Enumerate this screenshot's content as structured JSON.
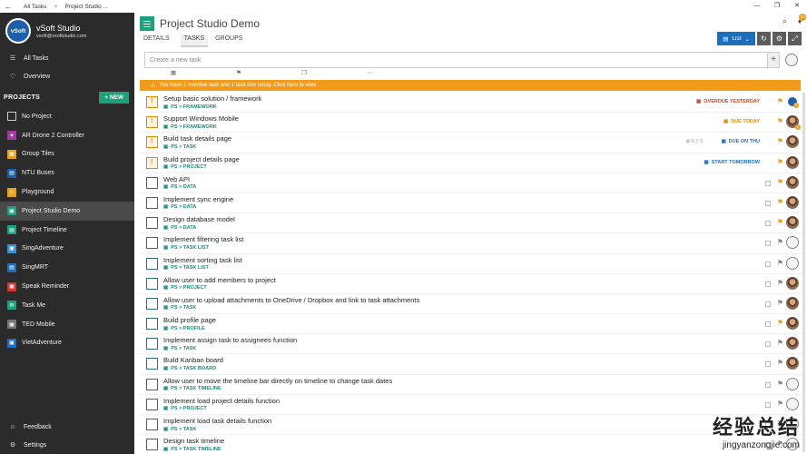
{
  "titlebar": {
    "back_icon": "back-arrow-icon",
    "crumb1": "All Tasks",
    "sep": ">",
    "crumb2": "Project Studio ...",
    "min": "—",
    "max": "❐",
    "close": "✕"
  },
  "account": {
    "logo_text": "vSoft",
    "name": "vSoft Studio",
    "email": "vsoft@vsoftstudio.com"
  },
  "nav": [
    {
      "label": "All Tasks",
      "icon": "☰"
    },
    {
      "label": "Overview",
      "icon": "♡"
    }
  ],
  "projects_header": {
    "label": "PROJECTS",
    "new_label": "+ NEW"
  },
  "projects": [
    {
      "label": "No Project",
      "color": "",
      "glyph": ""
    },
    {
      "label": "AR Drone 2 Controller",
      "color": "#a23aa6",
      "glyph": "✦"
    },
    {
      "label": "Group Tiles",
      "color": "#e6a21a",
      "glyph": "▦"
    },
    {
      "label": "NTU Buses",
      "color": "#1d5fa8",
      "glyph": "▤"
    },
    {
      "label": "Playground",
      "color": "#e6a21a",
      "glyph": "◇"
    },
    {
      "label": "Project Studio Demo",
      "color": "#1aa37a",
      "glyph": "▣"
    },
    {
      "label": "Project Timeline",
      "color": "#1aa37a",
      "glyph": "▤"
    },
    {
      "label": "SingAdventure",
      "color": "#3a8fd1",
      "glyph": "▣"
    },
    {
      "label": "SingMRT",
      "color": "#1d6fbd",
      "glyph": "▤"
    },
    {
      "label": "Speak Reminder",
      "color": "#d13a2b",
      "glyph": "▣"
    },
    {
      "label": "Task Me",
      "color": "#1aa37a",
      "glyph": "✉"
    },
    {
      "label": "TED Mobile",
      "color": "#777777",
      "glyph": "▣"
    },
    {
      "label": "VietAdventure",
      "color": "#1d6fbd",
      "glyph": "▣"
    }
  ],
  "bottom_nav": [
    {
      "label": "Feedback",
      "icon": "☺"
    },
    {
      "label": "Settings",
      "icon": "⚙"
    }
  ],
  "header": {
    "title": "Project Studio Demo",
    "search_icon": "⌕",
    "bell_icon": "🔔",
    "bell_count": "20"
  },
  "tabs": [
    {
      "label": "DETAILS"
    },
    {
      "label": "TASKS"
    },
    {
      "label": "GROUPS"
    }
  ],
  "toolbar": {
    "list_label": "List",
    "list_icon": "▤",
    "chevron": "⌄",
    "refresh": "↻",
    "settings": "⚙",
    "expand": "⤢"
  },
  "newtask": {
    "placeholder": "Create a new task",
    "add": "+",
    "icons": [
      "▦",
      "⚑",
      "❐",
      "⋯"
    ]
  },
  "warning": {
    "icon": "⚠",
    "text": "You have 1 overdue task and 1 task due today. Click here to view"
  },
  "tasks": [
    {
      "name": "Setup basic solution / framework",
      "path": "PS > FRAMEWORK",
      "overdue": true,
      "due": "OVERDUE YESTERDAY",
      "due_class": "red",
      "due_icon": "▦",
      "flag": "orange",
      "avatar": "logo",
      "count": "1"
    },
    {
      "name": "Support Windows Mobile",
      "path": "PS > FRAMEWORK",
      "overdue": true,
      "due": "DUE TODAY",
      "due_class": "orange",
      "due_icon": "▦",
      "flag": "orange",
      "avatar": "photo",
      "count": "1"
    },
    {
      "name": "Build task details page",
      "path": "PS > TASK",
      "overdue": true,
      "due": "DUE ON THU",
      "due_class": "blue",
      "due_icon": "▦",
      "sub": "⊞ 6   ▯ 3",
      "flag": "orange",
      "avatar": "photo"
    },
    {
      "name": "Build project details page",
      "path": "PS > PROJECT",
      "overdue": true,
      "due": "START TOMORROW",
      "due_class": "blue",
      "due_icon": "▦",
      "flag": "orange",
      "avatar": "photo"
    },
    {
      "name": "Web API",
      "path": "PS > DATA",
      "cal": true,
      "flag": "orange",
      "avatar": "photo"
    },
    {
      "name": "Implement sync engine",
      "path": "PS > DATA",
      "cal": true,
      "flag": "orange",
      "avatar": "photo"
    },
    {
      "name": "Design database model",
      "path": "PS > DATA",
      "cal": true,
      "flag": "orange",
      "avatar": "photo"
    },
    {
      "name": "Implement filtering task list",
      "path": "PS > TASK LIST",
      "cal": true,
      "flag": "grey",
      "avatar": "empty"
    },
    {
      "name": "Implement sorting task list",
      "path": "PS > TASK LIST",
      "cal": true,
      "flag": "grey",
      "avatar": "empty"
    },
    {
      "name": "Allow user to add members to project",
      "path": "PS > PROJECT",
      "cal": true,
      "flag": "grey",
      "avatar": "photo"
    },
    {
      "name": "Allow user to upload attachments to OneDrive / Dropbox and link to task attachments",
      "path": "PS > TASK",
      "cal": true,
      "flag": "grey",
      "avatar": "photo"
    },
    {
      "name": "Build profile page",
      "path": "PS > PROFILE",
      "cal": true,
      "flag": "orange",
      "avatar": "photo"
    },
    {
      "name": "Implement assign task to assignees function",
      "path": "PS > TASK",
      "cal": true,
      "flag": "grey",
      "avatar": "photo"
    },
    {
      "name": "Build Kanban board",
      "path": "PS > TASK BOARD",
      "cal": true,
      "flag": "grey",
      "avatar": "photo"
    },
    {
      "name": "Allow user to move the timeline bar directly on timeline to change task dates",
      "path": "PS > TASK TIMELINE",
      "cal": true,
      "flag": "grey",
      "avatar": "empty"
    },
    {
      "name": "Implement load project details function",
      "path": "PS > PROJECT",
      "cal": true,
      "flag": "grey",
      "avatar": "empty"
    },
    {
      "name": "Implement load task details function",
      "path": "PS > TASK",
      "cal": true,
      "flag": "grey",
      "avatar": "empty"
    },
    {
      "name": "Design task timeline",
      "path": "PS > TASK TIMELINE",
      "cal": true,
      "flag": "grey",
      "avatar": "empty"
    }
  ],
  "watermark": {
    "cn": "经验总结",
    "en": "jingyanzongjie.com"
  }
}
